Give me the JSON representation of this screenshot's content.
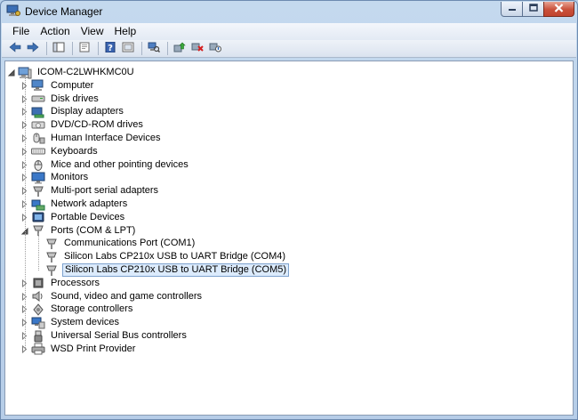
{
  "window": {
    "title": "Device Manager"
  },
  "menu": [
    "File",
    "Action",
    "View",
    "Help"
  ],
  "toolbar": [
    "back-arrow-icon",
    "forward-arrow-icon",
    "show-hide-console-tree-icon",
    "properties-icon",
    "help-icon",
    "show-hidden-icon",
    "scan-hardware-icon",
    "update-driver-icon",
    "uninstall-icon",
    "disable-icon"
  ],
  "tree": {
    "root": "ICOM-C2LWHKMC0U",
    "categories": [
      {
        "label": "Computer",
        "icon": "computer-icon"
      },
      {
        "label": "Disk drives",
        "icon": "disk-drive-icon"
      },
      {
        "label": "Display adapters",
        "icon": "display-adapter-icon"
      },
      {
        "label": "DVD/CD-ROM drives",
        "icon": "dvd-drive-icon"
      },
      {
        "label": "Human Interface Devices",
        "icon": "hid-icon"
      },
      {
        "label": "Keyboards",
        "icon": "keyboard-icon"
      },
      {
        "label": "Mice and other pointing devices",
        "icon": "mouse-icon"
      },
      {
        "label": "Monitors",
        "icon": "monitor-icon"
      },
      {
        "label": "Multi-port serial adapters",
        "icon": "serial-adapter-icon"
      },
      {
        "label": "Network adapters",
        "icon": "network-adapter-icon"
      },
      {
        "label": "Portable Devices",
        "icon": "portable-device-icon"
      },
      {
        "label": "Ports (COM & LPT)",
        "icon": "port-icon",
        "expanded": true,
        "children": [
          {
            "label": "Communications Port (COM1)",
            "icon": "port-icon"
          },
          {
            "label": "Silicon Labs CP210x USB to UART Bridge (COM4)",
            "icon": "port-icon"
          },
          {
            "label": "Silicon Labs CP210x USB to UART Bridge (COM5)",
            "icon": "port-icon",
            "selected": true
          }
        ]
      },
      {
        "label": "Processors",
        "icon": "processor-icon"
      },
      {
        "label": "Sound, video and game controllers",
        "icon": "sound-icon"
      },
      {
        "label": "Storage controllers",
        "icon": "storage-controller-icon"
      },
      {
        "label": "System devices",
        "icon": "system-device-icon"
      },
      {
        "label": "Universal Serial Bus controllers",
        "icon": "usb-icon"
      },
      {
        "label": "WSD Print Provider",
        "icon": "printer-icon"
      }
    ]
  }
}
